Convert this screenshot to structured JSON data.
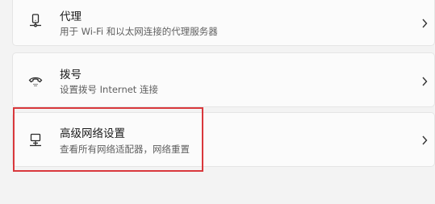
{
  "settings": {
    "items": [
      {
        "title": "代理",
        "description": "用于 Wi-Fi 和以太网连接的代理服务器",
        "icon": "proxy-icon"
      },
      {
        "title": "拨号",
        "description": "设置拨号 Internet 连接",
        "icon": "dial-up-icon"
      },
      {
        "title": "高级网络设置",
        "description": "查看所有网络适配器，网络重置",
        "icon": "network-adapter-icon"
      }
    ]
  },
  "colors": {
    "page_background": "#f3f3f3",
    "card_background": "#fbfbfb",
    "card_border": "#e5e5e5",
    "highlight_border": "#d9383c",
    "title_text": "#1a1a1a",
    "description_text": "#5f5f5f"
  }
}
